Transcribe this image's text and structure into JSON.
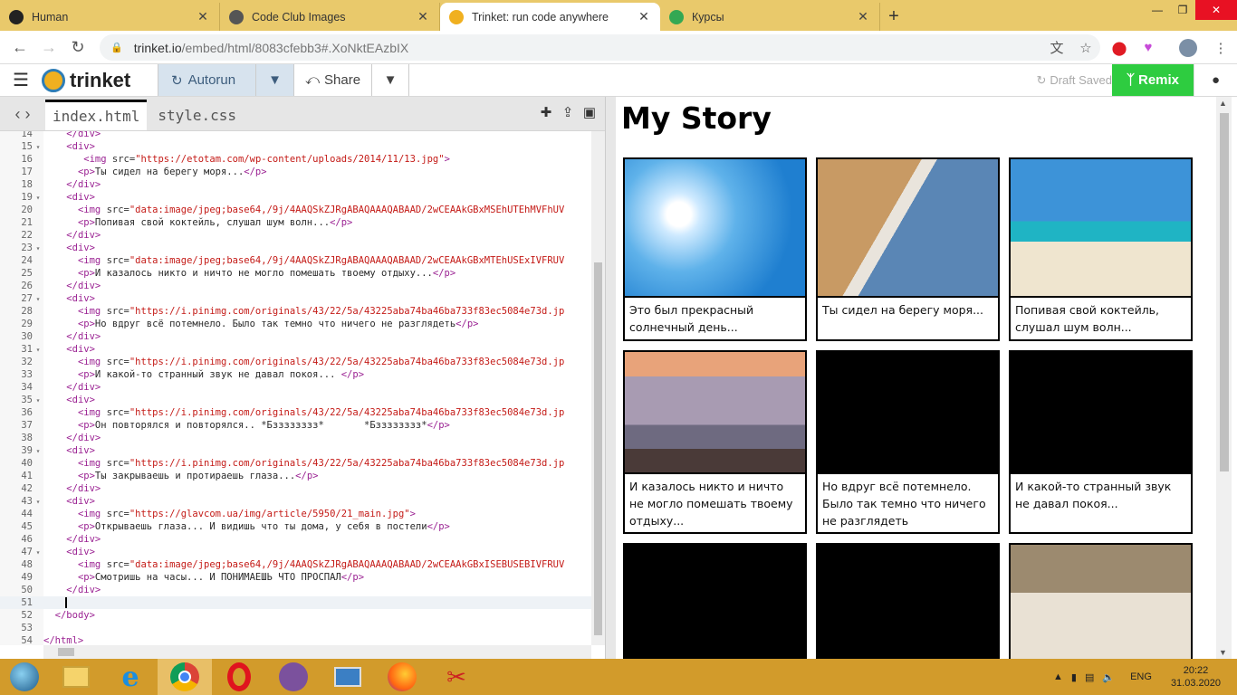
{
  "browser": {
    "tabs": [
      {
        "title": "Human",
        "active": false,
        "icon": "circle-icon",
        "color": "#222222"
      },
      {
        "title": "Code Club Images",
        "active": false,
        "icon": "globe-icon",
        "color": "#555555"
      },
      {
        "title": "Trinket: run code anywhere",
        "active": true,
        "icon": "trinket-icon",
        "color": "#f0b020"
      },
      {
        "title": "Курсы",
        "active": false,
        "icon": "course-icon",
        "color": "#34a853"
      }
    ],
    "url_main": "trinket.io",
    "url_rest": "/embed/html/8083cfebb3#.XoNktEAzbIX"
  },
  "toolbar": {
    "logo": "trinket",
    "autorun": "Autorun",
    "share": "Share",
    "draft": "Draft Saved",
    "remix": "Remix"
  },
  "editor": {
    "files": [
      "index.html",
      "style.css"
    ],
    "active_file": "index.html",
    "lines": [
      {
        "n": "14",
        "fold": false,
        "html": "    <span class='tag'>&lt;/div&gt;</span>"
      },
      {
        "n": "15",
        "fold": true,
        "html": "    <span class='tag'>&lt;div&gt;</span>"
      },
      {
        "n": "16",
        "fold": false,
        "html": "       <span class='tag'>&lt;img</span> <span class='attr'>src=</span><span class='str'>\"https://etotam.com/wp-content/uploads/2014/11/13.jpg\"</span><span class='tag'>&gt;</span>"
      },
      {
        "n": "17",
        "fold": false,
        "html": "      <span class='tag'>&lt;p&gt;</span>Ты сидел на берегу моря...<span class='tag'>&lt;/p&gt;</span>"
      },
      {
        "n": "18",
        "fold": false,
        "html": "    <span class='tag'>&lt;/div&gt;</span>"
      },
      {
        "n": "19",
        "fold": true,
        "html": "    <span class='tag'>&lt;div&gt;</span>"
      },
      {
        "n": "20",
        "fold": false,
        "html": "      <span class='tag'>&lt;img</span> <span class='attr'>src=</span><span class='str'>\"data:image/jpeg;base64,/9j/4AAQSkZJRgABAQAAAQABAAD/2wCEAAkGBxMSEhUTEhMVFhUV</span>"
      },
      {
        "n": "21",
        "fold": false,
        "html": "      <span class='tag'>&lt;p&gt;</span>Попивая свой коктейль, слушал шум волн...<span class='tag'>&lt;/p&gt;</span>"
      },
      {
        "n": "22",
        "fold": false,
        "html": "    <span class='tag'>&lt;/div&gt;</span>"
      },
      {
        "n": "23",
        "fold": true,
        "html": "    <span class='tag'>&lt;div&gt;</span>"
      },
      {
        "n": "24",
        "fold": false,
        "html": "      <span class='tag'>&lt;img</span> <span class='attr'>src=</span><span class='str'>\"data:image/jpeg;base64,/9j/4AAQSkZJRgABAQAAAQABAAD/2wCEAAkGBxMTEhUSExIVFRUV</span>"
      },
      {
        "n": "25",
        "fold": false,
        "html": "      <span class='tag'>&lt;p&gt;</span>И казалось никто и ничто не могло помешать твоему отдыху...<span class='tag'>&lt;/p&gt;</span>"
      },
      {
        "n": "26",
        "fold": false,
        "html": "    <span class='tag'>&lt;/div&gt;</span>"
      },
      {
        "n": "27",
        "fold": true,
        "html": "    <span class='tag'>&lt;div&gt;</span>"
      },
      {
        "n": "28",
        "fold": false,
        "html": "      <span class='tag'>&lt;img</span> <span class='attr'>src=</span><span class='str'>\"https://i.pinimg.com/originals/43/22/5a/43225aba74ba46ba733f83ec5084e73d.jp</span>"
      },
      {
        "n": "29",
        "fold": false,
        "html": "      <span class='tag'>&lt;p&gt;</span>Но вдруг всё потемнело. Было так темно что ничего не разглядеть<span class='tag'>&lt;/p&gt;</span>"
      },
      {
        "n": "30",
        "fold": false,
        "html": "    <span class='tag'>&lt;/div&gt;</span>"
      },
      {
        "n": "31",
        "fold": true,
        "html": "    <span class='tag'>&lt;div&gt;</span>"
      },
      {
        "n": "32",
        "fold": false,
        "html": "      <span class='tag'>&lt;img</span> <span class='attr'>src=</span><span class='str'>\"https://i.pinimg.com/originals/43/22/5a/43225aba74ba46ba733f83ec5084e73d.jp</span>"
      },
      {
        "n": "33",
        "fold": false,
        "html": "      <span class='tag'>&lt;p&gt;</span>И какой-то странный звук не давал покоя... <span class='tag'>&lt;/p&gt;</span>"
      },
      {
        "n": "34",
        "fold": false,
        "html": "    <span class='tag'>&lt;/div&gt;</span>"
      },
      {
        "n": "35",
        "fold": true,
        "html": "    <span class='tag'>&lt;div&gt;</span>"
      },
      {
        "n": "36",
        "fold": false,
        "html": "      <span class='tag'>&lt;img</span> <span class='attr'>src=</span><span class='str'>\"https://i.pinimg.com/originals/43/22/5a/43225aba74ba46ba733f83ec5084e73d.jp</span>"
      },
      {
        "n": "37",
        "fold": false,
        "html": "      <span class='tag'>&lt;p&gt;</span>Он повторялся и повторялся.. *Бзззззззз*       *Бзззззззз*<span class='tag'>&lt;/p&gt;</span>"
      },
      {
        "n": "38",
        "fold": false,
        "html": "    <span class='tag'>&lt;/div&gt;</span>"
      },
      {
        "n": "39",
        "fold": true,
        "html": "    <span class='tag'>&lt;div&gt;</span>"
      },
      {
        "n": "40",
        "fold": false,
        "html": "      <span class='tag'>&lt;img</span> <span class='attr'>src=</span><span class='str'>\"https://i.pinimg.com/originals/43/22/5a/43225aba74ba46ba733f83ec5084e73d.jp</span>"
      },
      {
        "n": "41",
        "fold": false,
        "html": "      <span class='tag'>&lt;p&gt;</span>Ты закрываешь и протираешь глаза...<span class='tag'>&lt;/p&gt;</span>"
      },
      {
        "n": "42",
        "fold": false,
        "html": "    <span class='tag'>&lt;/div&gt;</span>"
      },
      {
        "n": "43",
        "fold": true,
        "html": "    <span class='tag'>&lt;div&gt;</span>"
      },
      {
        "n": "44",
        "fold": false,
        "html": "      <span class='tag'>&lt;img</span> <span class='attr'>src=</span><span class='str'>\"https://glavcom.ua/img/article/5950/21_main.jpg\"</span><span class='tag'>&gt;</span>"
      },
      {
        "n": "45",
        "fold": false,
        "html": "      <span class='tag'>&lt;p&gt;</span>Открываешь глаза... И видишь что ты дома, у себя в постели<span class='tag'>&lt;/p&gt;</span>"
      },
      {
        "n": "46",
        "fold": false,
        "html": "    <span class='tag'>&lt;/div&gt;</span>"
      },
      {
        "n": "47",
        "fold": true,
        "html": "    <span class='tag'>&lt;div&gt;</span>"
      },
      {
        "n": "48",
        "fold": false,
        "html": "      <span class='tag'>&lt;img</span> <span class='attr'>src=</span><span class='str'>\"data:image/jpeg;base64,/9j/4AAQSkZJRgABAQAAAQABAAD/2wCEAAkGBxISEBUSEBIVFRUV</span>"
      },
      {
        "n": "49",
        "fold": false,
        "html": "      <span class='tag'>&lt;p&gt;</span>Смотришь на часы... И ПОНИМАЕШЬ ЧТО ПРОСПАЛ<span class='tag'>&lt;/p&gt;</span>"
      },
      {
        "n": "50",
        "fold": false,
        "html": "    <span class='tag'>&lt;/div&gt;</span>"
      },
      {
        "n": "51",
        "fold": false,
        "html": "    ",
        "cursor": true
      },
      {
        "n": "52",
        "fold": false,
        "html": "  <span class='tag'>&lt;/body&gt;</span>"
      },
      {
        "n": "53",
        "fold": false,
        "html": ""
      },
      {
        "n": "54",
        "fold": false,
        "html": "<span class='tag'>&lt;/html&gt;</span>"
      }
    ]
  },
  "preview": {
    "title": "My Story",
    "cards": [
      {
        "caption": "Это был прекрасный солнечный день...",
        "image": "sun-sky",
        "tall": false
      },
      {
        "caption": "Ты сидел на берегу моря...",
        "image": "desert-coast",
        "tall": false
      },
      {
        "caption": "Попивая свой коктейль, слушал шум волн...",
        "image": "beach-cocktail",
        "tall": false
      },
      {
        "caption": "И казалось никто и ничто не могло помешать твоему отдыху...",
        "image": "sunset-sea",
        "tall": true
      },
      {
        "caption": "Но вдруг всё потемнело. Было так темно что ничего не разглядеть",
        "image": "black",
        "tall": true
      },
      {
        "caption": "И какой-то странный звук не давал покоя...",
        "image": "black",
        "tall": true
      },
      {
        "caption": "",
        "image": "black",
        "tall": false
      },
      {
        "caption": "",
        "image": "black",
        "tall": false
      },
      {
        "caption": "",
        "image": "bedroom",
        "tall": false
      }
    ]
  },
  "taskbar": {
    "apps": [
      "start-orb",
      "file-explorer",
      "internet-explorer",
      "chrome",
      "opera",
      "viber",
      "remote-desktop",
      "firefox",
      "paint"
    ],
    "lang": "ENG",
    "time": "20:22",
    "date": "31.03.2020"
  }
}
